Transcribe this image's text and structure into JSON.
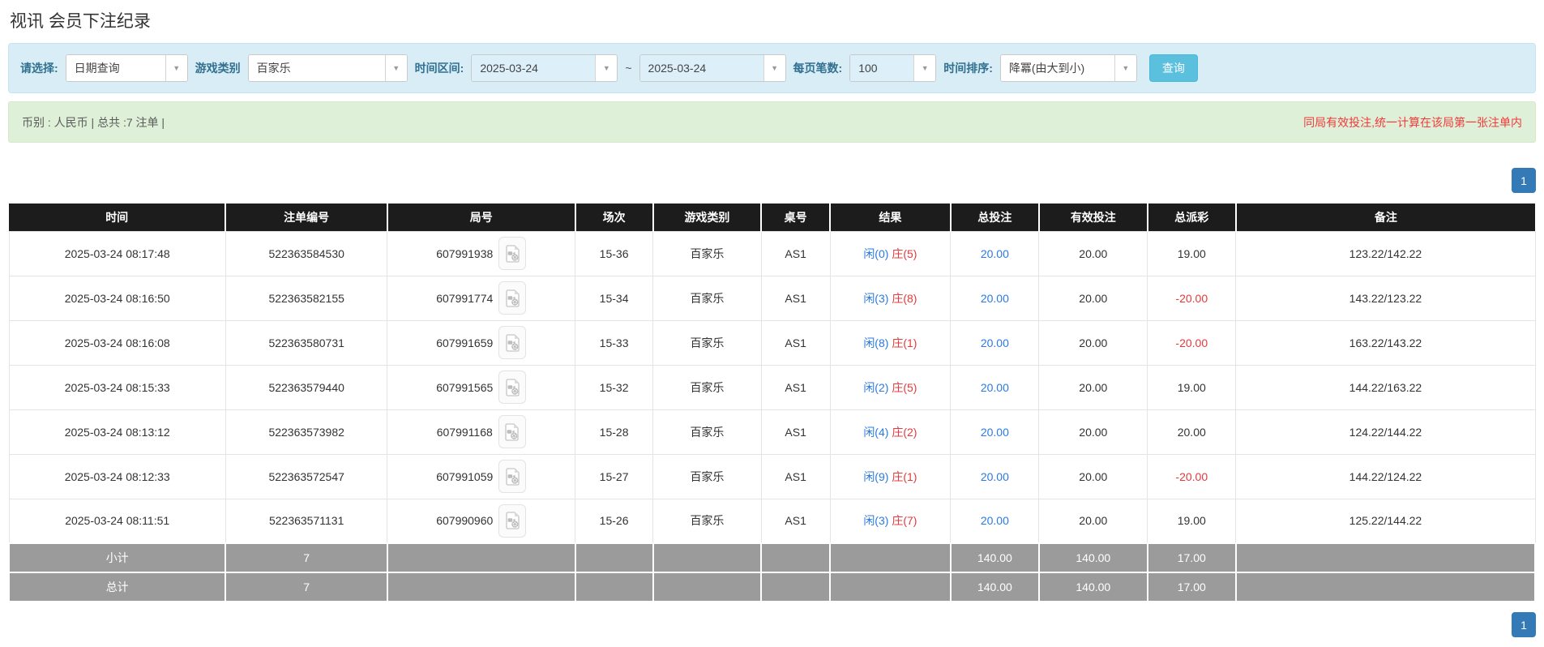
{
  "page": {
    "title": "视讯 会员下注纪录"
  },
  "colors": {
    "accent_blue": "#337ab7",
    "filter_bg": "#d9edf7",
    "filter_label_text": "#31708f",
    "search_button_cyan": "#5bc0de",
    "summary_bg": "#dff0d8",
    "alert_red": "#e4393c",
    "link_blue": "#2a7ae2",
    "table_header_black": "#1c1c1c",
    "summary_row_gray": "#9b9b9b"
  },
  "filters": {
    "select_label": "请选择:",
    "select_value": "日期查询",
    "game_label": "游戏类别",
    "game_value": "百家乐",
    "range_label": "时间区间:",
    "date_from": "2025-03-24",
    "tilde": "~",
    "date_to": "2025-03-24",
    "page_size_label": "每页笔数:",
    "page_size_value": "100",
    "sort_label": "时间排序:",
    "sort_value": "降冪(由大到小)",
    "search_button": "查询",
    "dropdown_arrow": "▼"
  },
  "summary_bar": {
    "left": "币别 : 人民币 | 总共 :7 注单 |",
    "right": "同局有效投注,统一计算在该局第一张注单内"
  },
  "pagination": {
    "page": "1"
  },
  "table": {
    "headers": [
      "时间",
      "注单编号",
      "局号",
      "场次",
      "游戏类别",
      "桌号",
      "结果",
      "总投注",
      "有效投注",
      "总派彩",
      "备注"
    ],
    "rows": [
      {
        "time": "2025-03-24 08:17:48",
        "bet_id": "522363584530",
        "round_id": "607991938",
        "session": "15-36",
        "game": "百家乐",
        "table_no": "AS1",
        "result_player": "闲(0)",
        "result_banker": "庄(5)",
        "total_bet": "20.00",
        "valid_bet": "20.00",
        "payout": "19.00",
        "payout_negative": false,
        "remark": "123.22/142.22"
      },
      {
        "time": "2025-03-24 08:16:50",
        "bet_id": "522363582155",
        "round_id": "607991774",
        "session": "15-34",
        "game": "百家乐",
        "table_no": "AS1",
        "result_player": "闲(3)",
        "result_banker": "庄(8)",
        "total_bet": "20.00",
        "valid_bet": "20.00",
        "payout": "-20.00",
        "payout_negative": true,
        "remark": "143.22/123.22"
      },
      {
        "time": "2025-03-24 08:16:08",
        "bet_id": "522363580731",
        "round_id": "607991659",
        "session": "15-33",
        "game": "百家乐",
        "table_no": "AS1",
        "result_player": "闲(8)",
        "result_banker": "庄(1)",
        "total_bet": "20.00",
        "valid_bet": "20.00",
        "payout": "-20.00",
        "payout_negative": true,
        "remark": "163.22/143.22"
      },
      {
        "time": "2025-03-24 08:15:33",
        "bet_id": "522363579440",
        "round_id": "607991565",
        "session": "15-32",
        "game": "百家乐",
        "table_no": "AS1",
        "result_player": "闲(2)",
        "result_banker": "庄(5)",
        "total_bet": "20.00",
        "valid_bet": "20.00",
        "payout": "19.00",
        "payout_negative": false,
        "remark": "144.22/163.22"
      },
      {
        "time": "2025-03-24 08:13:12",
        "bet_id": "522363573982",
        "round_id": "607991168",
        "session": "15-28",
        "game": "百家乐",
        "table_no": "AS1",
        "result_player": "闲(4)",
        "result_banker": "庄(2)",
        "total_bet": "20.00",
        "valid_bet": "20.00",
        "payout": "20.00",
        "payout_negative": false,
        "remark": "124.22/144.22"
      },
      {
        "time": "2025-03-24 08:12:33",
        "bet_id": "522363572547",
        "round_id": "607991059",
        "session": "15-27",
        "game": "百家乐",
        "table_no": "AS1",
        "result_player": "闲(9)",
        "result_banker": "庄(1)",
        "total_bet": "20.00",
        "valid_bet": "20.00",
        "payout": "-20.00",
        "payout_negative": true,
        "remark": "144.22/124.22"
      },
      {
        "time": "2025-03-24 08:11:51",
        "bet_id": "522363571131",
        "round_id": "607990960",
        "session": "15-26",
        "game": "百家乐",
        "table_no": "AS1",
        "result_player": "闲(3)",
        "result_banker": "庄(7)",
        "total_bet": "20.00",
        "valid_bet": "20.00",
        "payout": "19.00",
        "payout_negative": false,
        "remark": "125.22/144.22"
      }
    ],
    "summary_rows": [
      {
        "label": "小计",
        "count": "7",
        "total_bet": "140.00",
        "valid_bet": "140.00",
        "payout": "17.00"
      },
      {
        "label": "总计",
        "count": "7",
        "total_bet": "140.00",
        "valid_bet": "140.00",
        "payout": "17.00"
      }
    ]
  }
}
